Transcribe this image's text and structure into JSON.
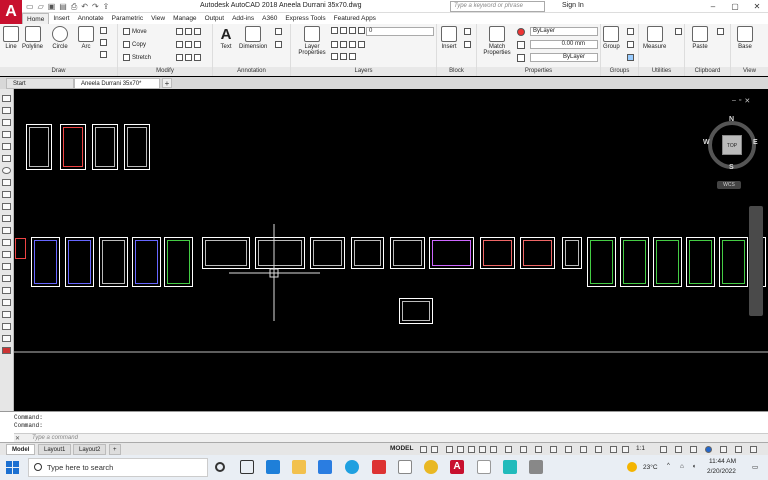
{
  "titlebar": {
    "title": "Autodesk AutoCAD 2018   Aneela Durrani 35x70.dwg",
    "search_placeholder": "Type a keyword or phrase",
    "signin": "Sign In"
  },
  "ribbon_tabs": [
    "Home",
    "Insert",
    "Annotate",
    "Parametric",
    "View",
    "Manage",
    "Output",
    "Add-ins",
    "A360",
    "Express Tools",
    "Featured Apps"
  ],
  "ribbon": {
    "draw": {
      "label": "Draw",
      "line": "Line",
      "polyline": "Polyline",
      "circle": "Circle",
      "arc": "Arc"
    },
    "modify": {
      "label": "Modify",
      "move": "Move",
      "copy": "Copy",
      "stretch": "Stretch"
    },
    "annotation": {
      "label": "Annotation",
      "text": "Text",
      "dimension": "Dimension"
    },
    "layers": {
      "label": "Layers",
      "layer_properties": "Layer\nProperties",
      "current_layer": "0"
    },
    "block": {
      "label": "Block",
      "insert": "Insert"
    },
    "properties": {
      "label": "Properties",
      "match": "Match\nProperties",
      "color": "ByLayer",
      "lineweight": "0.00 mm",
      "linetype": "ByLayer"
    },
    "groups": {
      "label": "Groups",
      "group": "Group"
    },
    "utilities": {
      "label": "Utilities",
      "measure": "Measure"
    },
    "clipboard": {
      "label": "Clipboard",
      "paste": "Paste"
    },
    "view": {
      "label": "View",
      "base": "Base"
    }
  },
  "doc_tabs": {
    "start": "Start",
    "active": "Aneela Durrani 35x70*"
  },
  "navcube": {
    "top": "TOP",
    "n": "N",
    "s": "S",
    "e": "E",
    "w": "W",
    "wcs": "WCS"
  },
  "command": {
    "line1": "Command:",
    "line2": "Command:",
    "placeholder": "Type a command"
  },
  "layout_tabs": [
    "Model",
    "Layout1",
    "Layout2"
  ],
  "status": {
    "model": "MODEL",
    "scale": "1:1"
  },
  "taskbar": {
    "search": "Type here to search",
    "weather": "23°C",
    "time": "11:44 AM",
    "date": "2/20/2022"
  }
}
